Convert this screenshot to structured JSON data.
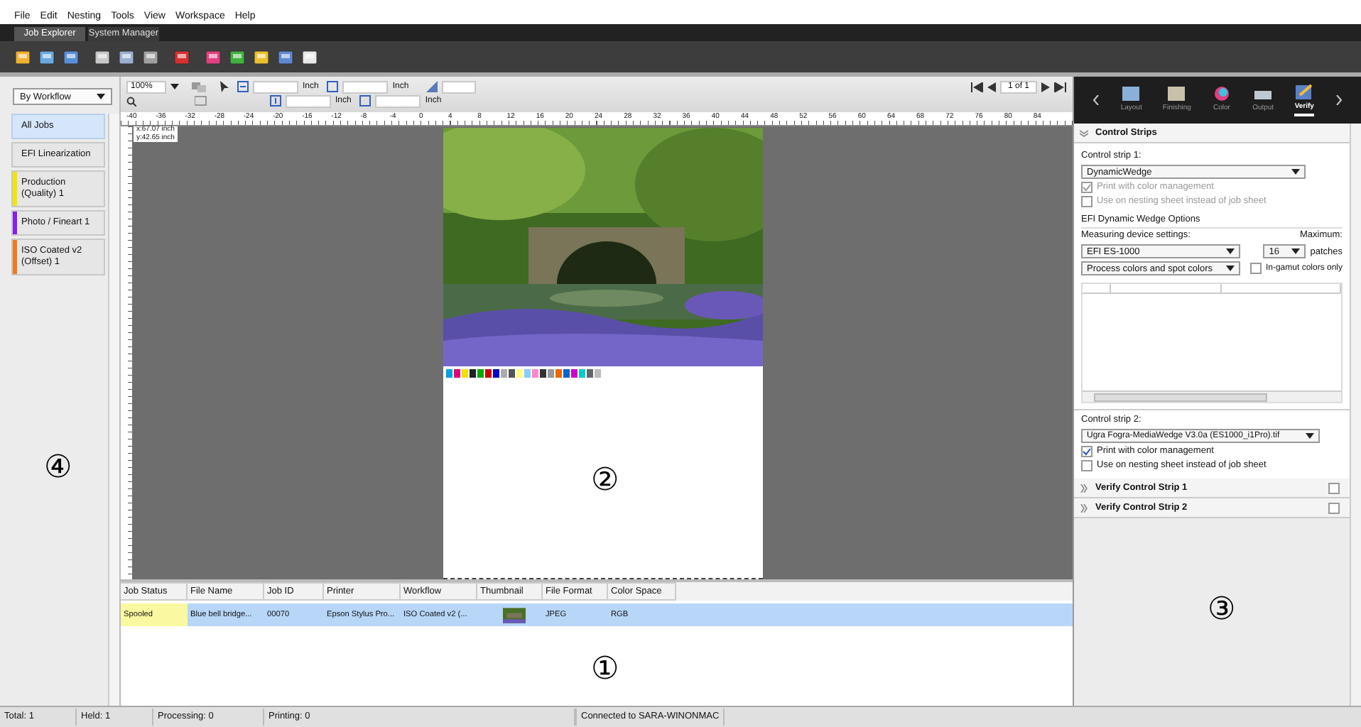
{
  "menu": [
    "File",
    "Edit",
    "Nesting",
    "Tools",
    "View",
    "Workspace",
    "Help"
  ],
  "tabs": [
    {
      "label": "Job Explorer",
      "selected": true
    },
    {
      "label": "System Manager",
      "selected": false
    }
  ],
  "sidebar": {
    "filter": "By Workflow",
    "items": [
      {
        "label": "All Jobs",
        "selected": true
      },
      {
        "label": "EFI Linearization",
        "selected": false
      },
      {
        "label": "Production (Quality) 1",
        "selected": false,
        "color": "#f2e600"
      },
      {
        "label": "Photo / Fineart 1",
        "selected": false,
        "color": "#8a1ee6"
      },
      {
        "label": "ISO Coated v2 (Offset) 1",
        "selected": false,
        "color": "#f07d1e"
      }
    ]
  },
  "view_toolbar": {
    "zoom": "100%",
    "units": [
      "Inch",
      "Inch",
      "Inch",
      "Inch"
    ],
    "page": "1 of 1"
  },
  "ruler": {
    "labels": [
      "-40",
      "-36",
      "-32",
      "-28",
      "-24",
      "-20",
      "-16",
      "-12",
      "-8",
      "-4",
      "0",
      "4",
      "8",
      "12",
      "16",
      "20",
      "24",
      "28",
      "32",
      "36",
      "40",
      "44",
      "48",
      "52",
      "56",
      "60",
      "64",
      "68",
      "72",
      "76",
      "80",
      "84"
    ]
  },
  "cursor": [
    "x:67.07 inch",
    "y:42.65 inch"
  ],
  "jobs": {
    "columns": [
      "Job Status",
      "File Name",
      "Job ID",
      "Printer",
      "Workflow",
      "Thumbnail",
      "File Format",
      "Color Space"
    ],
    "rows": [
      {
        "status": "Spooled",
        "file_name": "Blue bell bridge...",
        "job_id": "00070",
        "printer": "Epson Stylus Pro...",
        "workflow": "ISO Coated v2 (...",
        "file_format": "JPEG",
        "color_space": "RGB",
        "selected": true
      }
    ]
  },
  "right_panel": {
    "tabs": [
      {
        "label": "Layout",
        "selected": false
      },
      {
        "label": "Finishing",
        "selected": false
      },
      {
        "label": "Color",
        "selected": false
      },
      {
        "label": "Output",
        "selected": false
      },
      {
        "label": "Verify",
        "selected": true
      }
    ],
    "sections": [
      {
        "title": "Control Strips",
        "expanded": true
      },
      {
        "title": "Verify Control Strip 1",
        "expanded": false,
        "checked": false
      },
      {
        "title": "Verify Control Strip 2",
        "expanded": false,
        "checked": false
      }
    ],
    "control_strip_1": {
      "label": "Control strip 1:",
      "value": "DynamicWedge",
      "options": [
        {
          "label": "Print with color management",
          "checked": true,
          "disabled": true
        },
        {
          "label": "Use on nesting sheet instead of job sheet",
          "checked": false,
          "disabled": true
        }
      ]
    },
    "wedge_options": {
      "title": "EFI Dynamic Wedge Options",
      "device_label": "Measuring device settings:",
      "device": "EFI ES-1000",
      "max_label": "Maximum:",
      "max": "16",
      "max_unit": "patches",
      "colors": "Process colors and spot colors",
      "in_gamut": {
        "label": "In-gamut colors only",
        "checked": false
      }
    },
    "control_strip_2": {
      "label": "Control strip 2:",
      "value": "Ugra Fogra-MediaWedge V3.0a (ES1000_i1Pro).tif",
      "options": [
        {
          "label": "Print with color management",
          "checked": true,
          "disabled": false
        },
        {
          "label": "Use on nesting sheet instead of job sheet",
          "checked": false,
          "disabled": false
        }
      ]
    }
  },
  "status_bar": [
    "Total: 1",
    "Held: 1",
    "Processing: 0",
    "Printing: 0",
    "Connected to SARA-WINONMAC"
  ],
  "callouts": [
    "①",
    "②",
    "③",
    "④"
  ]
}
